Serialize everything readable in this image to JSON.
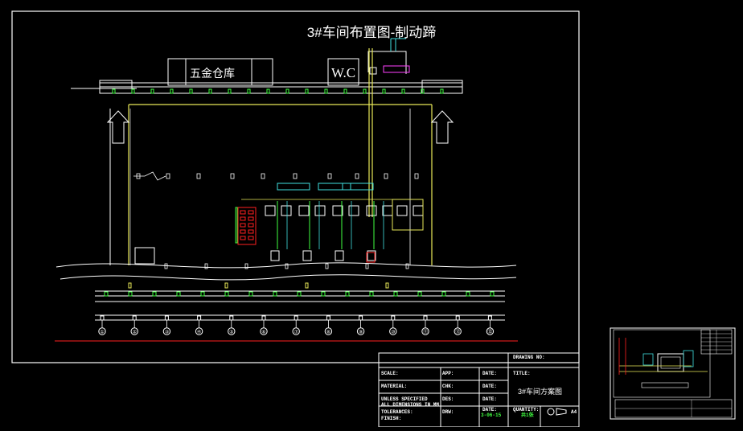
{
  "drawing": {
    "title": "3#车间布置图-制动蹄",
    "warehouse_label": "五金仓库",
    "wc_label": "W.C",
    "axis_markers": [
      "①",
      "②",
      "③",
      "④",
      "⑤",
      "⑥",
      "⑦",
      "⑧",
      "⑨",
      "⑩",
      "⑪",
      "⑫",
      "⑬"
    ]
  },
  "title_block": {
    "drawing_no": "DRAWING NO:",
    "title_key": "TITLE:",
    "scale": "SCALE:",
    "material": "MATERIAL:",
    "app": "APP:",
    "chk": "CHK:",
    "des": "DES:",
    "drw": "DRW:",
    "date1": "DATE:",
    "date2": "DATE:",
    "date3": "DATE:",
    "date4": "DATE:",
    "unless": "UNLESS SPECIFIED",
    "all_dims": "ALL DIMENSIONS IN MM",
    "tolerances": "TOLERANCES:",
    "finish": "FINISH:",
    "quantity": "QUANTITY:",
    "drawing_name": "3#车间方案图",
    "date_value": "3-06-15",
    "sheet": "共1张",
    "size": "A4"
  },
  "colors": {
    "frame": "#ffffff",
    "wall": "#e8e858",
    "machine": "#ffffff",
    "cyan": "#40e0e0",
    "green": "#40ff40",
    "red": "#ff2020",
    "magenta": "#ff40ff"
  }
}
